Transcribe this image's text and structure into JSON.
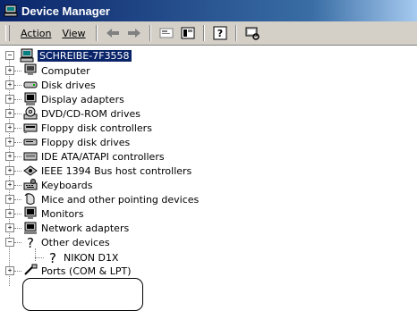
{
  "window": {
    "title": "Device Manager",
    "icon": "device-manager-icon"
  },
  "menu": {
    "action_label": "Action",
    "view_label": "View"
  },
  "toolbar": {
    "buttons": [
      "back-icon",
      "forward-icon",
      "properties-icon",
      "view-icon",
      "help-icon",
      "scan-hardware-icon"
    ]
  },
  "tree": {
    "root": "SCHREIBE-7F3558",
    "items": [
      {
        "label": "Computer",
        "icon": "computer-icon"
      },
      {
        "label": "Disk drives",
        "icon": "disk-drive-icon"
      },
      {
        "label": "Display adapters",
        "icon": "display-adapter-icon"
      },
      {
        "label": "DVD/CD-ROM drives",
        "icon": "cdrom-icon"
      },
      {
        "label": "Floppy disk controllers",
        "icon": "floppy-controller-icon"
      },
      {
        "label": "Floppy disk drives",
        "icon": "floppy-drive-icon"
      },
      {
        "label": "IDE ATA/ATAPI controllers",
        "icon": "ide-controller-icon"
      },
      {
        "label": "IEEE 1394 Bus host controllers",
        "icon": "ieee1394-icon"
      },
      {
        "label": "Keyboards",
        "icon": "keyboard-icon"
      },
      {
        "label": "Mice and other pointing devices",
        "icon": "mouse-icon"
      },
      {
        "label": "Monitors",
        "icon": "monitor-icon"
      },
      {
        "label": "Network adapters",
        "icon": "network-adapter-icon"
      },
      {
        "label": "Other devices",
        "icon": "unknown-device-icon"
      },
      {
        "label": "NIKON D1X",
        "icon": "unknown-device-icon"
      },
      {
        "label": "Ports (COM & LPT)",
        "icon": "port-icon"
      }
    ]
  },
  "colors": {
    "titlebar": "#0a246a",
    "selection": "#0a246a",
    "chrome": "#d4d0c8"
  }
}
